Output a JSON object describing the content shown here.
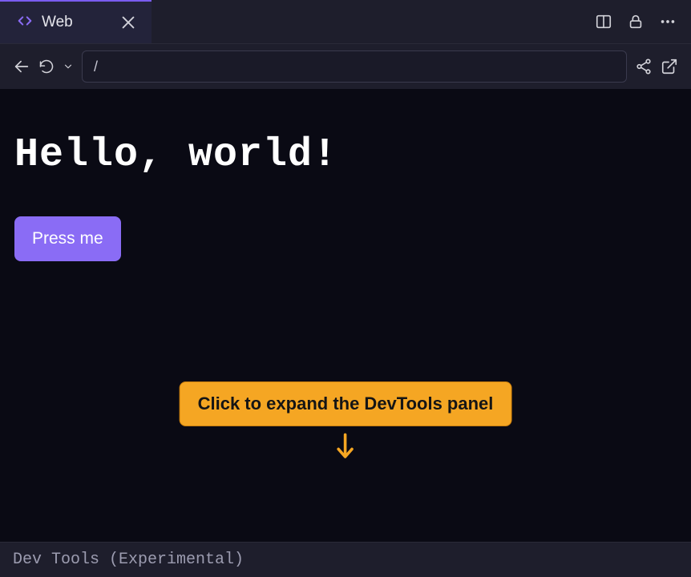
{
  "tab": {
    "label": "Web"
  },
  "toolbar": {
    "url": "/"
  },
  "page": {
    "heading": "Hello, world!",
    "button_label": "Press me"
  },
  "tooltip": {
    "text": "Click to expand the DevTools panel"
  },
  "devtools": {
    "label": "Dev Tools (Experimental)"
  },
  "colors": {
    "accent": "#7a5cf0",
    "button": "#8a6cf5",
    "tooltip_bg": "#f5a623"
  }
}
